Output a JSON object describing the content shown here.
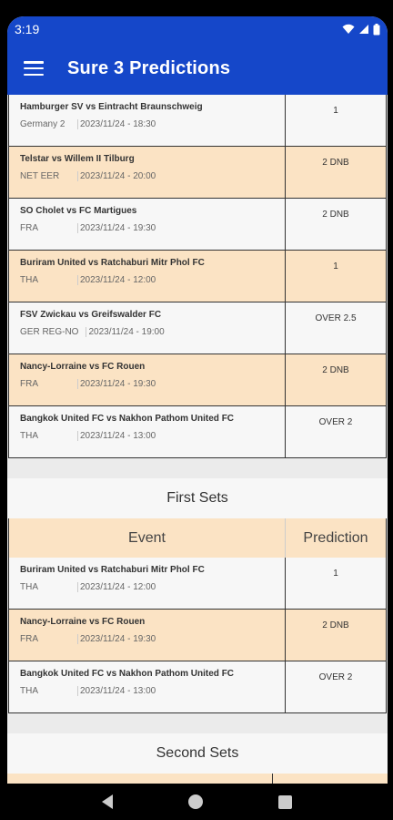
{
  "status": {
    "time": "3:19"
  },
  "app": {
    "title": "Sure 3 Predictions"
  },
  "main_rows": [
    {
      "match": "Hamburger SV vs Eintracht Braunschweig",
      "league": "Germany 2",
      "time": "2023/11/24 - 18:30",
      "prediction": "1",
      "style": "plain"
    },
    {
      "match": "Telstar vs Willem II Tilburg",
      "league": "NET EER",
      "time": "2023/11/24 - 20:00",
      "prediction": "2 DNB",
      "style": "alt"
    },
    {
      "match": "SO Cholet vs FC Martigues",
      "league": "FRA",
      "time": "2023/11/24 - 19:30",
      "prediction": "2 DNB",
      "style": "plain"
    },
    {
      "match": "Buriram United vs Ratchaburi Mitr Phol FC",
      "league": "THA",
      "time": "2023/11/24 - 12:00",
      "prediction": "1",
      "style": "alt"
    },
    {
      "match": "FSV Zwickau vs Greifswalder FC",
      "league": "GER REG-NO",
      "time": "2023/11/24 - 19:00",
      "prediction": "OVER 2.5",
      "style": "plain"
    },
    {
      "match": "Nancy-Lorraine vs FC Rouen",
      "league": "FRA",
      "time": "2023/11/24 - 19:30",
      "prediction": "2 DNB",
      "style": "alt"
    },
    {
      "match": "Bangkok United FC vs Nakhon Pathom United FC",
      "league": "THA",
      "time": "2023/11/24 - 13:00",
      "prediction": "OVER 2",
      "style": "plain"
    }
  ],
  "first_sets": {
    "title": "First Sets",
    "col_event": "Event",
    "col_prediction": "Prediction",
    "rows": [
      {
        "match": "Buriram United vs Ratchaburi Mitr Phol FC",
        "league": "THA",
        "time": "2023/11/24 - 12:00",
        "prediction": "1",
        "style": "plain"
      },
      {
        "match": "Nancy-Lorraine vs FC Rouen",
        "league": "FRA",
        "time": "2023/11/24 - 19:30",
        "prediction": "2 DNB",
        "style": "alt"
      },
      {
        "match": "Bangkok United FC vs Nakhon Pathom United FC",
        "league": "THA",
        "time": "2023/11/24 - 13:00",
        "prediction": "OVER 2",
        "style": "plain"
      }
    ]
  },
  "second_sets": {
    "title": "Second Sets"
  },
  "colors": {
    "appbar": "#1547c9",
    "row_alt": "#fbe3c4",
    "row_plain": "#f7f7f7"
  },
  "icons": {
    "menu": "hamburger-menu-icon",
    "wifi": "wifi-icon",
    "signal": "signal-icon",
    "battery": "battery-icon"
  }
}
